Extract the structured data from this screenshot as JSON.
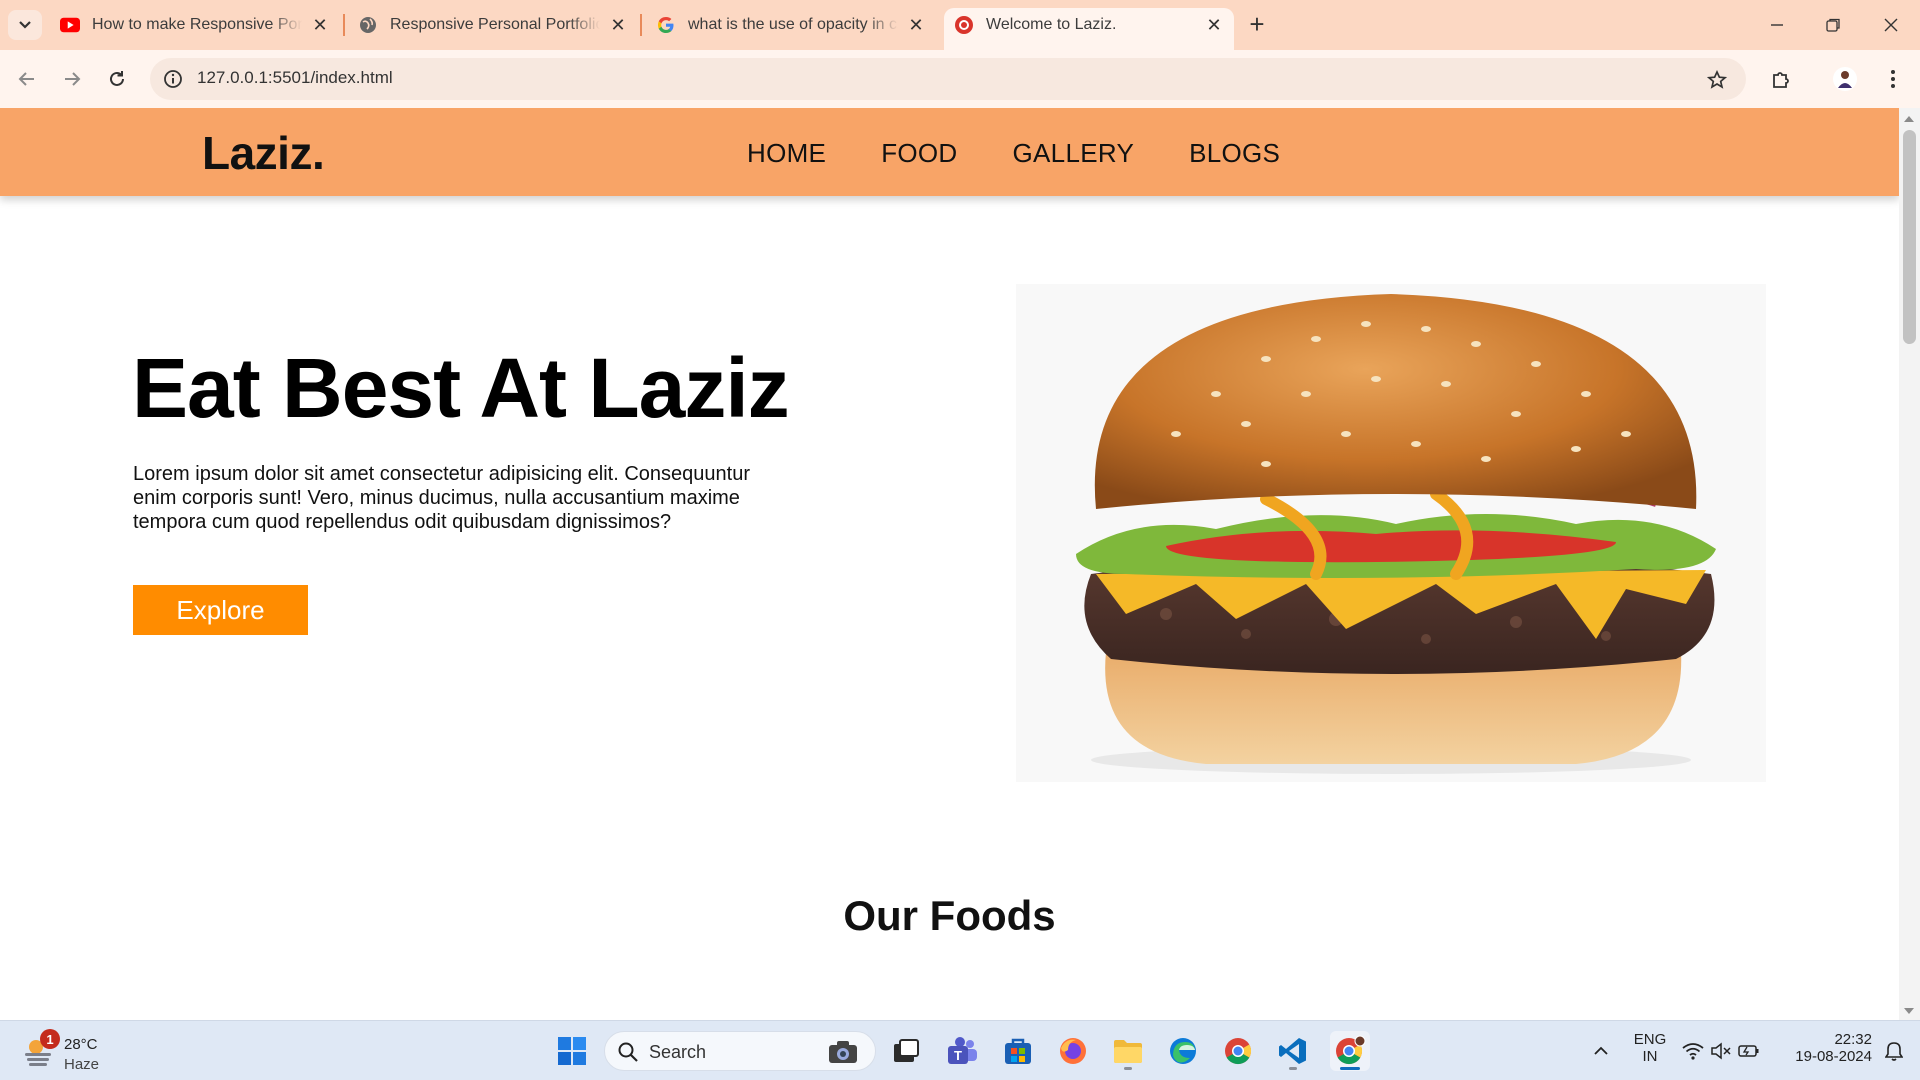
{
  "browser": {
    "tabs": [
      {
        "title": "How to make Responsive Portfolio",
        "favicon": "youtube-icon",
        "active": false
      },
      {
        "title": "Responsive Personal Portfolio Website",
        "favicon": "globe-icon",
        "active": false
      },
      {
        "title": "what is the use of opacity in css",
        "favicon": "google-icon",
        "active": false
      },
      {
        "title": "Welcome to Laziz.",
        "favicon": "laziz-icon",
        "active": true
      }
    ],
    "url": "127.0.0.1:5501/index.html"
  },
  "site": {
    "logo": "Laziz.",
    "nav": [
      "HOME",
      "FOOD",
      "GALLERY",
      "BLOGS"
    ],
    "hero": {
      "title": "Eat Best At Laziz",
      "text": "Lorem ipsum dolor sit amet consectetur adipisicing elit. Consequuntur enim corporis sunt! Vero, minus ducimus, nulla accusantium maxime tempora cum quod repellendus odit quibusdam dignissimos?",
      "button": "Explore",
      "image": "burger-image"
    },
    "section_title": "Our Foods",
    "colors": {
      "header": "#f8a467",
      "button": "#ff8c00"
    }
  },
  "taskbar": {
    "weather": {
      "temp": "28°C",
      "condition": "Haze",
      "badge": "1"
    },
    "search_placeholder": "Search",
    "lang": {
      "line1": "ENG",
      "line2": "IN"
    },
    "time": "22:32",
    "date": "19-08-2024"
  }
}
